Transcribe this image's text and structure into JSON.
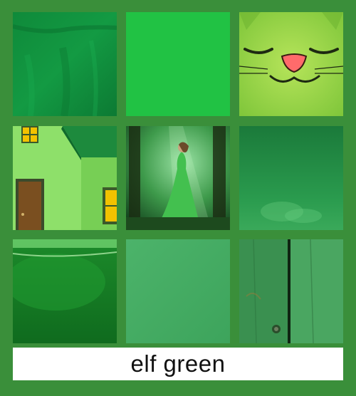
{
  "caption": "elf green",
  "colors": {
    "background": "#3a8f3a",
    "caption_bg": "#ffffff",
    "caption_text": "#111111"
  },
  "tiles": [
    {
      "name": "green-fabric-swatch"
    },
    {
      "name": "solid-bright-green-swatch"
    },
    {
      "name": "smiling-green-cat-face"
    },
    {
      "name": "green-house-with-door"
    },
    {
      "name": "woman-in-green-dress-forest"
    },
    {
      "name": "green-misty-gradient"
    },
    {
      "name": "green-glossy-cup-closeup"
    },
    {
      "name": "muted-green-swatch"
    },
    {
      "name": "green-painted-wood-plank"
    }
  ]
}
